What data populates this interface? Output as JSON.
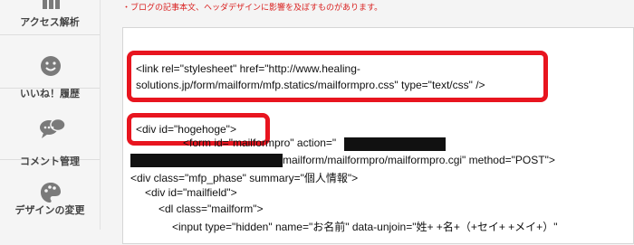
{
  "sidebar": {
    "items": [
      {
        "label": "アクセス解析",
        "icon": "bar-chart-icon"
      },
      {
        "label": "いいね！履歴",
        "icon": "smiley-icon"
      },
      {
        "label": "コメント管理",
        "icon": "speech-bubbles-icon"
      },
      {
        "label": "デザインの変更",
        "icon": "palette-icon"
      }
    ]
  },
  "main": {
    "notice": "・ブログの記事本文、ヘッダデザインに影響を及ぼすものがあります。",
    "code_lines": [
      "<link rel=\"stylesheet\" href=\"http://www.healing-",
      "solutions.jp/form/mailform/mfp.statics/mailformpro.css\" type=\"text/css\" />",
      "<div id=\"hogehoge\">",
      "<form id=\"mailformpro\" action=\"",
      "mailform/mailformpro/mailformpro.cgi\" method=\"POST\">",
      "<div class=\"mfp_phase\" summary=\"個人情報\">",
      "<div id=\"mailfield\">",
      "<dl class=\"mailform\">",
      "<input type=\"hidden\" name=\"お名前\" data-unjoin=\"姓+ +名+（+セイ+ +メイ+）\""
    ]
  },
  "colors": {
    "highlight": "#e8151f",
    "notice_text": "#d9201f",
    "redaction": "#111111"
  }
}
